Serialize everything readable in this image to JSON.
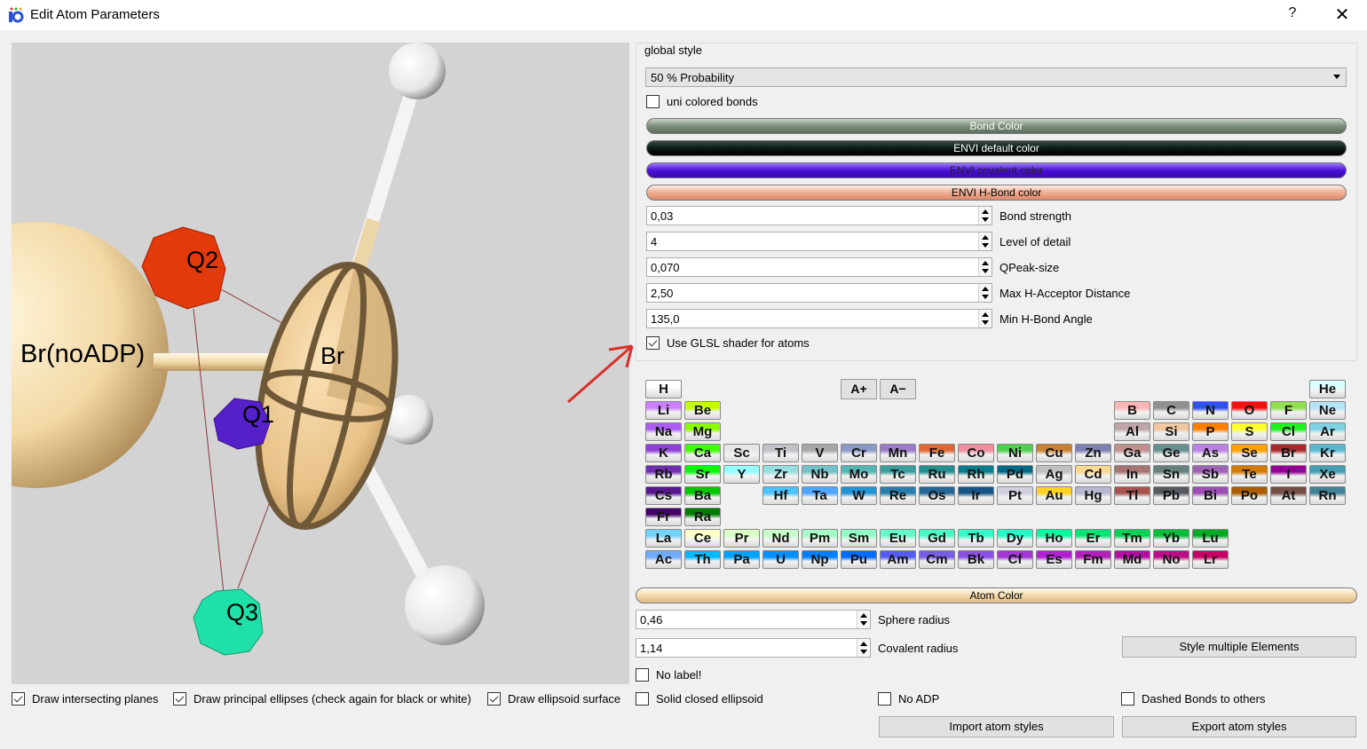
{
  "window": {
    "title": "Edit Atom Parameters",
    "help": "?",
    "close": "✕"
  },
  "viewport": {
    "labels": {
      "brnoadp": "Br(noADP)",
      "br": "Br",
      "q1": "Q1",
      "q2": "Q2",
      "q3": "Q3"
    }
  },
  "global_style": {
    "title": "global style",
    "style_select": "50 % Probability",
    "uni_colored_bonds": {
      "label": "uni colored bonds",
      "checked": false
    },
    "color_buttons": [
      {
        "label": "Bond Color",
        "color": "#7c8f7c"
      },
      {
        "label": "ENVI default color",
        "color": "#0a1a14"
      },
      {
        "label": "ENVI covalent color",
        "color": "#4b10d8"
      },
      {
        "label": "ENVI H-Bond color",
        "color": "#e6a083"
      }
    ],
    "fields": [
      {
        "value": "0,03",
        "label": "Bond strength"
      },
      {
        "value": "4",
        "label": "Level of detail"
      },
      {
        "value": "0,070",
        "label": "QPeak-size"
      },
      {
        "value": "2,50",
        "label": "Max H-Acceptor Distance"
      },
      {
        "value": "135,0",
        "label": "Min H-Bond Angle"
      }
    ],
    "glsl": {
      "label": "Use GLSL shader for atoms",
      "checked": true
    }
  },
  "font_buttons": {
    "bigger": "A+",
    "smaller": "A−"
  },
  "atom": {
    "color_label": "Atom Color",
    "sphere_radius": {
      "value": "0,46",
      "label": "Sphere radius"
    },
    "covalent_radius": {
      "value": "1,14",
      "label": "Covalent radius"
    },
    "style_multiple": "Style multiple Elements"
  },
  "checks": {
    "no_label": "No label!",
    "solid_closed": "Solid closed ellipsoid",
    "no_adp": "No ADP",
    "dashed_bonds": "Dashed Bonds to others",
    "intersecting": "Draw intersecting planes",
    "principal": "Draw principal ellipses (check again for black or white)",
    "surface": "Draw ellipsoid surface"
  },
  "buttons": {
    "import": "Import atom styles",
    "export": "Export atom styles"
  },
  "elements": [
    [
      "H",
      0,
      0,
      "#ffffff"
    ],
    [
      "He",
      0,
      17,
      "#d9ffff"
    ],
    [
      "Li",
      1,
      0,
      "#cc80ff"
    ],
    [
      "Be",
      1,
      1,
      "#c2ff00"
    ],
    [
      "B",
      1,
      12,
      "#ffb5b5"
    ],
    [
      "C",
      1,
      13,
      "#909090"
    ],
    [
      "N",
      1,
      14,
      "#3050f8"
    ],
    [
      "O",
      1,
      15,
      "#ff0d0d"
    ],
    [
      "F",
      1,
      16,
      "#90e050"
    ],
    [
      "Ne",
      1,
      17,
      "#b3e3f5"
    ],
    [
      "Na",
      2,
      0,
      "#ab5cf2"
    ],
    [
      "Mg",
      2,
      1,
      "#8aff00"
    ],
    [
      "Al",
      2,
      12,
      "#bfa6a6"
    ],
    [
      "Si",
      2,
      13,
      "#f0c8a0"
    ],
    [
      "P",
      2,
      14,
      "#ff8000"
    ],
    [
      "S",
      2,
      15,
      "#ffff30"
    ],
    [
      "Cl",
      2,
      16,
      "#1ff01f"
    ],
    [
      "Ar",
      2,
      17,
      "#80d1e3"
    ],
    [
      "K",
      3,
      0,
      "#8f40d4"
    ],
    [
      "Ca",
      3,
      1,
      "#3dff00"
    ],
    [
      "Sc",
      3,
      2,
      "#e6e6e6"
    ],
    [
      "Ti",
      3,
      3,
      "#bfc2c7"
    ],
    [
      "V",
      3,
      4,
      "#a6a6ab"
    ],
    [
      "Cr",
      3,
      5,
      "#8a99c7"
    ],
    [
      "Mn",
      3,
      6,
      "#9c7ac7"
    ],
    [
      "Fe",
      3,
      7,
      "#e06633"
    ],
    [
      "Co",
      3,
      8,
      "#f090a0"
    ],
    [
      "Ni",
      3,
      9,
      "#50d050"
    ],
    [
      "Cu",
      3,
      10,
      "#c88033"
    ],
    [
      "Zn",
      3,
      11,
      "#7d80b0"
    ],
    [
      "Ga",
      3,
      12,
      "#c28f8f"
    ],
    [
      "Ge",
      3,
      13,
      "#668f8f"
    ],
    [
      "As",
      3,
      14,
      "#bd80e3"
    ],
    [
      "Se",
      3,
      15,
      "#ffa100"
    ],
    [
      "Br",
      3,
      16,
      "#a62929"
    ],
    [
      "Kr",
      3,
      17,
      "#5cb8d1"
    ],
    [
      "Rb",
      4,
      0,
      "#702eb0"
    ],
    [
      "Sr",
      4,
      1,
      "#00ff00"
    ],
    [
      "Y",
      4,
      2,
      "#94ffff"
    ],
    [
      "Zr",
      4,
      3,
      "#94e0e0"
    ],
    [
      "Nb",
      4,
      4,
      "#73c2c9"
    ],
    [
      "Mo",
      4,
      5,
      "#54b5b5"
    ],
    [
      "Tc",
      4,
      6,
      "#3b9e9e"
    ],
    [
      "Ru",
      4,
      7,
      "#248f8f"
    ],
    [
      "Rh",
      4,
      8,
      "#0a7d8c"
    ],
    [
      "Pd",
      4,
      9,
      "#006985"
    ],
    [
      "Ag",
      4,
      10,
      "#c0c0c0"
    ],
    [
      "Cd",
      4,
      11,
      "#ffd98f"
    ],
    [
      "In",
      4,
      12,
      "#a67573"
    ],
    [
      "Sn",
      4,
      13,
      "#668080"
    ],
    [
      "Sb",
      4,
      14,
      "#9e63b5"
    ],
    [
      "Te",
      4,
      15,
      "#d47a00"
    ],
    [
      "I",
      4,
      16,
      "#940094"
    ],
    [
      "Xe",
      4,
      17,
      "#429eb0"
    ],
    [
      "Cs",
      5,
      0,
      "#57178f"
    ],
    [
      "Ba",
      5,
      1,
      "#00c900"
    ],
    [
      "Hf",
      5,
      3,
      "#4dc2ff"
    ],
    [
      "Ta",
      5,
      4,
      "#4da6ff"
    ],
    [
      "W",
      5,
      5,
      "#2194d6"
    ],
    [
      "Re",
      5,
      6,
      "#267dab"
    ],
    [
      "Os",
      5,
      7,
      "#266696"
    ],
    [
      "Ir",
      5,
      8,
      "#175487"
    ],
    [
      "Pt",
      5,
      9,
      "#d0d0e0"
    ],
    [
      "Au",
      5,
      10,
      "#ffd123"
    ],
    [
      "Hg",
      5,
      11,
      "#b8b8d0"
    ],
    [
      "Tl",
      5,
      12,
      "#a6544d"
    ],
    [
      "Pb",
      5,
      13,
      "#575961"
    ],
    [
      "Bi",
      5,
      14,
      "#9e4fb5"
    ],
    [
      "Po",
      5,
      15,
      "#ab5c00"
    ],
    [
      "At",
      5,
      16,
      "#754f45"
    ],
    [
      "Rn",
      5,
      17,
      "#428296"
    ],
    [
      "Fr",
      6,
      0,
      "#420066"
    ],
    [
      "Ra",
      6,
      1,
      "#007d00"
    ],
    [
      "La",
      7,
      0,
      "#70d4ff"
    ],
    [
      "Ce",
      7,
      1,
      "#ffffc7"
    ],
    [
      "Pr",
      7,
      2,
      "#d9ffc7"
    ],
    [
      "Nd",
      7,
      3,
      "#c7ffc7"
    ],
    [
      "Pm",
      7,
      4,
      "#a3ffc7"
    ],
    [
      "Sm",
      7,
      5,
      "#8fffc7"
    ],
    [
      "Eu",
      7,
      6,
      "#61ffc7"
    ],
    [
      "Gd",
      7,
      7,
      "#45ffc7"
    ],
    [
      "Tb",
      7,
      8,
      "#30ffc7"
    ],
    [
      "Dy",
      7,
      9,
      "#1fffc7"
    ],
    [
      "Ho",
      7,
      10,
      "#00ff9c"
    ],
    [
      "Er",
      7,
      11,
      "#00e675"
    ],
    [
      "Tm",
      7,
      12,
      "#00d452"
    ],
    [
      "Yb",
      7,
      13,
      "#00bf38"
    ],
    [
      "Lu",
      7,
      14,
      "#00ab24"
    ],
    [
      "Ac",
      8,
      0,
      "#70abfa"
    ],
    [
      "Th",
      8,
      1,
      "#00baff"
    ],
    [
      "Pa",
      8,
      2,
      "#00a1ff"
    ],
    [
      "U",
      8,
      3,
      "#008fff"
    ],
    [
      "Np",
      8,
      4,
      "#0080ff"
    ],
    [
      "Pu",
      8,
      5,
      "#006bff"
    ],
    [
      "Am",
      8,
      6,
      "#545cf2"
    ],
    [
      "Cm",
      8,
      7,
      "#785ce3"
    ],
    [
      "Bk",
      8,
      8,
      "#8a4fe3"
    ],
    [
      "Cf",
      8,
      9,
      "#a136d4"
    ],
    [
      "Es",
      8,
      10,
      "#b31fd4"
    ],
    [
      "Fm",
      8,
      11,
      "#b31fba"
    ],
    [
      "Md",
      8,
      12,
      "#b30da6"
    ],
    [
      "No",
      8,
      13,
      "#bd0d87"
    ],
    [
      "Lr",
      8,
      14,
      "#c70066"
    ]
  ]
}
